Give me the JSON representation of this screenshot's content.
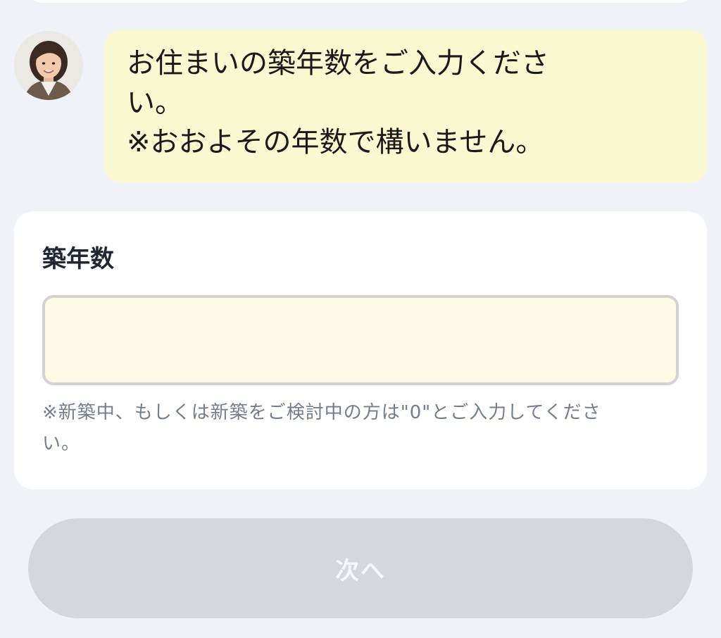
{
  "chat": {
    "avatar_icon": "person-photo-icon",
    "message_lines": [
      "お住まいの築年数をご入力くださ",
      "い。",
      "※おおよその年数で構いません。"
    ]
  },
  "form": {
    "label": "築年数",
    "input": {
      "value": "",
      "placeholder": ""
    },
    "note_lines": [
      "※新築中、もしくは新築をご検討中の方は\"0\"とご入力してくださ",
      "い。"
    ]
  },
  "footer": {
    "next_label": "次へ",
    "next_enabled": false
  },
  "colors": {
    "page_background": "#eff2f7",
    "bubble_background": "#f9f8d0",
    "input_background": "#fdfae6",
    "button_disabled": "#d4d7dc",
    "note_text": "#737d8c"
  }
}
